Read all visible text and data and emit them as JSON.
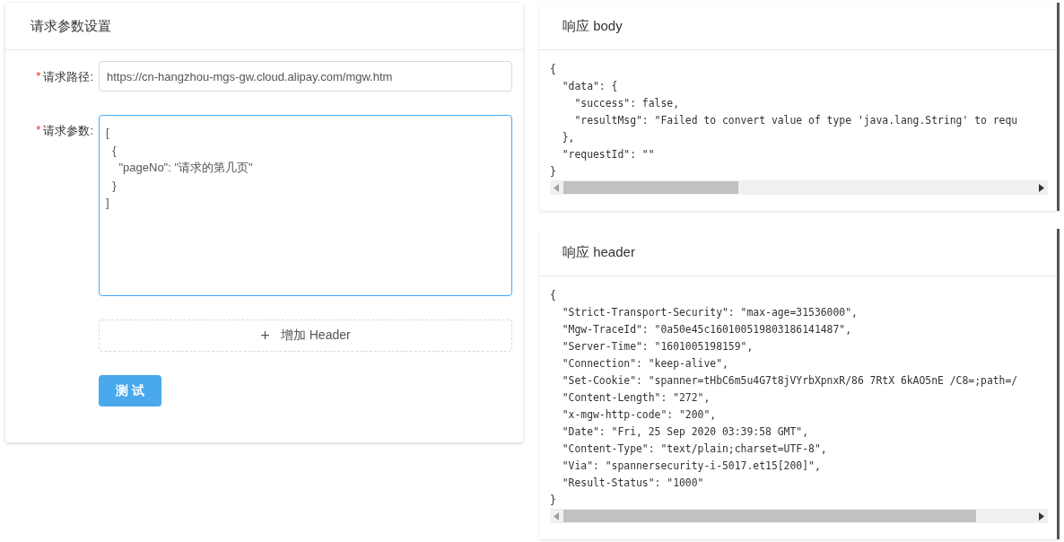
{
  "request_card": {
    "title": "请求参数设置",
    "required_mark": "*",
    "fields": [
      {
        "kind": "input",
        "required": true,
        "label": "请求路径:",
        "value": "https://cn-hangzhou-mgs-gw.cloud.alipay.com/mgw.htm",
        "focused": false
      },
      {
        "kind": "textarea",
        "required": true,
        "label": "请求参数:",
        "value": "[\n  {\n    \"pageNo\": \"请求的第几页\"\n  }\n]",
        "focused": true
      }
    ],
    "add_header_button": {
      "icon": "+",
      "label": "增加 Header"
    },
    "test_button": "测 试"
  },
  "response_panels": [
    {
      "title": "响应 body",
      "lines": [
        "{",
        "  \"data\": {",
        "    \"success\": false,",
        "    \"resultMsg\": \"Failed to convert value of type 'java.lang.String' to requ",
        "  },",
        "  \"requestId\": \"\"",
        "}"
      ]
    },
    {
      "title": "响应 header",
      "lines": [
        "{",
        "  \"Strict-Transport-Security\": \"max-age=31536000\",",
        "  \"Mgw-TraceId\": \"0a50e45c160100519803186141487\",",
        "  \"Server-Time\": \"1601005198159\",",
        "  \"Connection\": \"keep-alive\",",
        "  \"Set-Cookie\": \"spanner=tHbC6m5u4G7t8jVYrbXpnxR/86 7RtX 6kAO5nE /C8=;path=/",
        "  \"Content-Length\": \"272\",",
        "  \"x-mgw-http-code\": \"200\",",
        "  \"Date\": \"Fri, 25 Sep 2020 03:39:58 GMT\",",
        "  \"Content-Type\": \"text/plain;charset=UTF-8\",",
        "  \"Via\": \"spannersecurity-i-5017.et15[200]\",",
        "  \"Result-Status\": \"1000\"",
        "}"
      ]
    }
  ]
}
